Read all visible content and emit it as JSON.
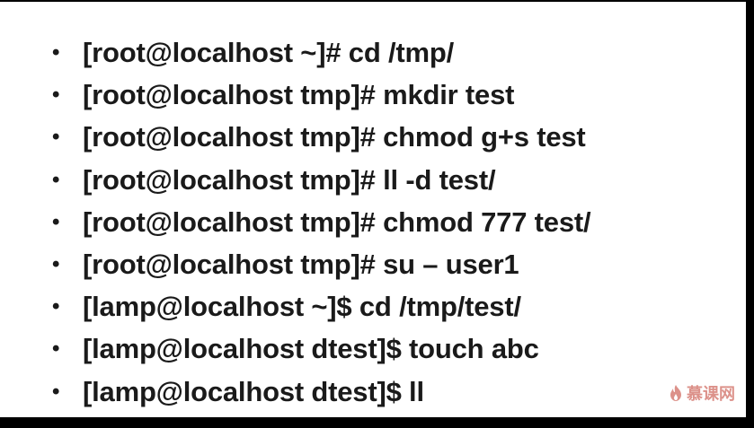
{
  "slide": {
    "lines": [
      "[root@localhost ~]# cd /tmp/",
      "[root@localhost tmp]# mkdir test",
      "[root@localhost tmp]# chmod g+s test",
      "[root@localhost tmp]# ll -d test/",
      "[root@localhost tmp]# chmod 777 test/",
      "[root@localhost tmp]# su – user1",
      "[lamp@localhost ~]$ cd /tmp/test/",
      "[lamp@localhost dtest]$ touch abc",
      "[lamp@localhost dtest]$ ll"
    ],
    "bullet": "•"
  },
  "watermark": {
    "text": "慕课网",
    "icon": "flame-logo-icon",
    "color": "#c0392b"
  }
}
